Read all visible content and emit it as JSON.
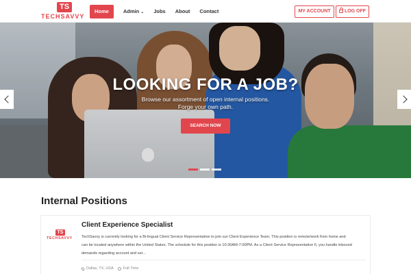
{
  "brand": {
    "logo_mark": "TS",
    "logo_text": "TECHSAVVY"
  },
  "nav": {
    "items": [
      {
        "label": "Home",
        "active": true
      },
      {
        "label": "Admin",
        "has_caret": true
      },
      {
        "label": "Jobs"
      },
      {
        "label": "About"
      },
      {
        "label": "Contact"
      }
    ],
    "caret": "⌄",
    "my_account": "MY ACCOUNT",
    "log_off": "LOG OFF"
  },
  "hero": {
    "title": "LOOKING FOR A JOB?",
    "subtitle_line1": "Browse our assortment of open internal positions.",
    "subtitle_line2": "Forge your own path.",
    "button": "SEARCH NOW",
    "slides_total": 3,
    "active_slide": 1
  },
  "positions": {
    "heading": "Internal Positions",
    "jobs": [
      {
        "logo_mark": "TS",
        "logo_text": "TECHSAVVY",
        "title": "Client Experience Specialist",
        "description": "TechSavvy is currently looking for a Bi-lingual Client Service Representative to join our Client Experience Team. This position is remote/work from home and can be located anywhere within the United States. The schedule for this position is 10:30AM-7:00PM. As a Client Service Representative II, you handle inbound demands regarding account and ser...",
        "location": "Dallas, TX, USA",
        "type": "Full-Time"
      }
    ]
  },
  "colors": {
    "accent": "#e2464d"
  }
}
